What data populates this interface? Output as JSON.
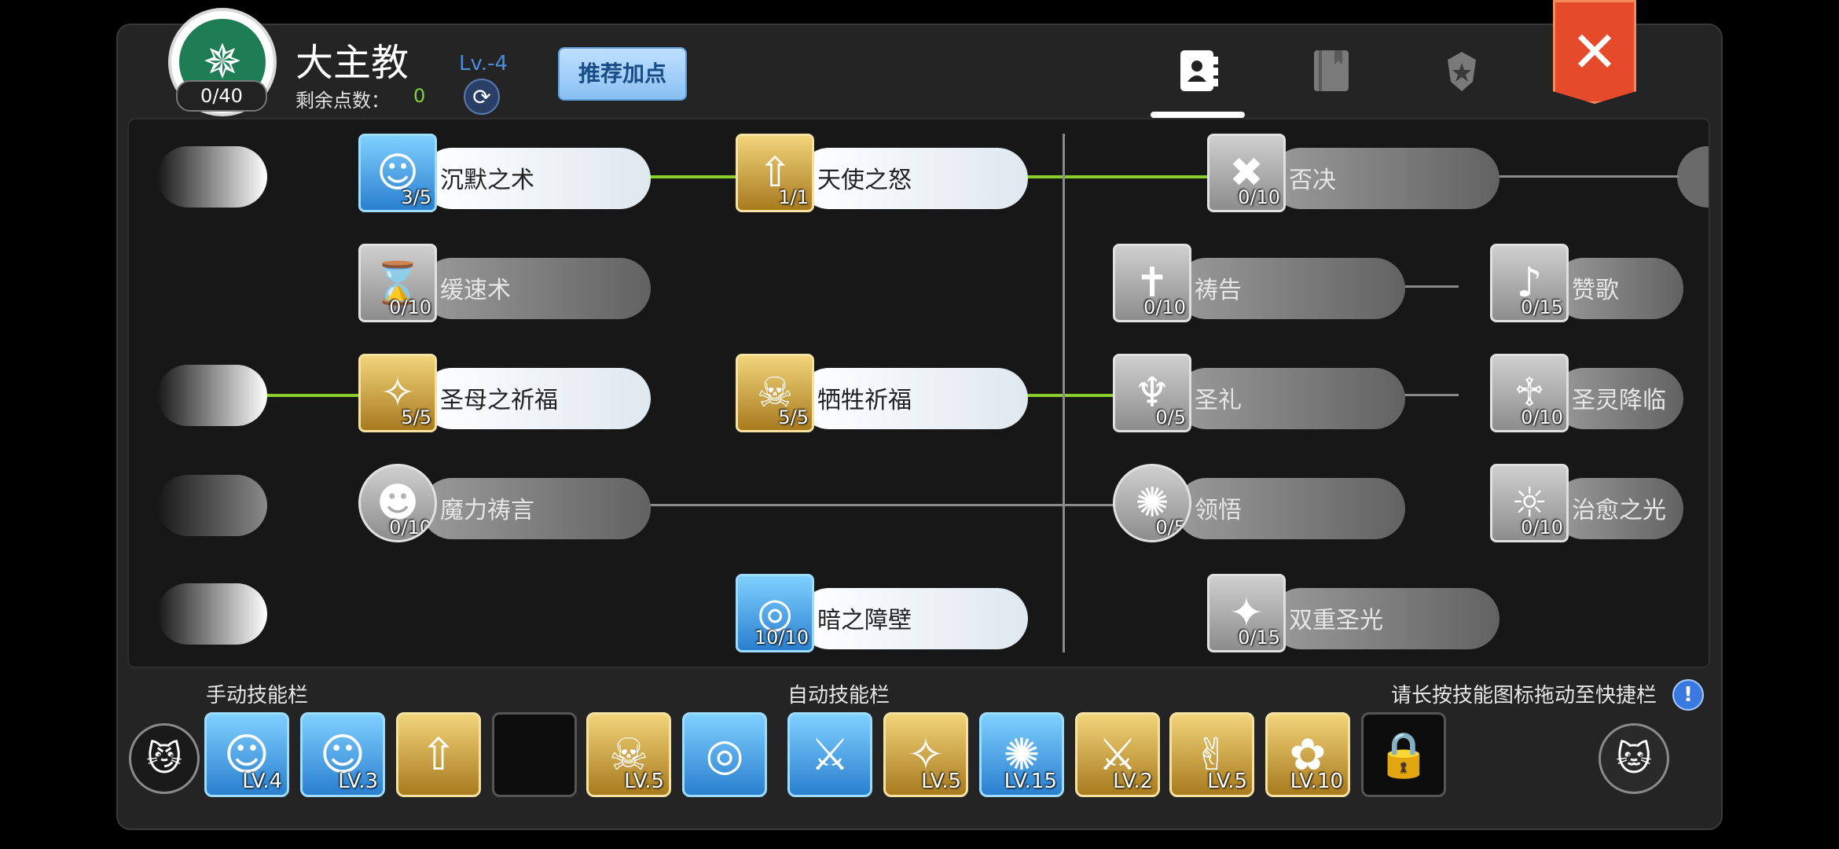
{
  "header": {
    "class_name": "大主教",
    "level": "Lv.-4",
    "remaining_label": "剩余点数：",
    "remaining_value": "0",
    "points_badge": "0/40",
    "recommend_label": "推荐加点",
    "close_label": "✕"
  },
  "tabs": [
    {
      "name": "skill-tree",
      "active": true
    },
    {
      "name": "skill-book",
      "active": false
    },
    {
      "name": "emblem",
      "active": false
    }
  ],
  "skills": [
    {
      "label": "沉默之术",
      "level": "3/5",
      "glyph": "☺",
      "style": "blue",
      "active": true
    },
    {
      "label": "缓速术",
      "level": "0/10",
      "glyph": "⌛",
      "style": "gray",
      "active": false
    },
    {
      "label": "圣母之祈福",
      "level": "5/5",
      "glyph": "✧",
      "style": "gold",
      "active": true
    },
    {
      "label": "魔力祷言",
      "level": "0/10",
      "glyph": "☻",
      "style": "gray",
      "active": false
    },
    {
      "label": "天使之怒",
      "level": "1/1",
      "glyph": "⇧",
      "style": "gold",
      "active": true
    },
    {
      "label": "牺牲祈福",
      "level": "5/5",
      "glyph": "☠",
      "style": "gold",
      "active": true
    },
    {
      "label": "暗之障壁",
      "level": "10/10",
      "glyph": "◎",
      "style": "blue",
      "active": true
    },
    {
      "label": "否决",
      "level": "0/10",
      "glyph": "✖",
      "style": "gray",
      "active": false
    },
    {
      "label": "祷告",
      "level": "0/10",
      "glyph": "✝",
      "style": "gray",
      "active": false
    },
    {
      "label": "圣礼",
      "level": "0/5",
      "glyph": "♆",
      "style": "gray",
      "active": false
    },
    {
      "label": "领悟",
      "level": "0/5",
      "glyph": "✺",
      "style": "gray",
      "active": false
    },
    {
      "label": "双重圣光",
      "level": "0/15",
      "glyph": "✦",
      "style": "gray",
      "active": false
    },
    {
      "label": "赞歌",
      "level": "0/15",
      "glyph": "♪",
      "style": "gray",
      "active": false
    },
    {
      "label": "圣灵降临",
      "level": "0/10",
      "glyph": "♱",
      "style": "gray",
      "active": false
    },
    {
      "label": "治愈之光",
      "level": "0/10",
      "glyph": "☼",
      "style": "gray",
      "active": false
    }
  ],
  "manual_bar": {
    "label": "手动技能栏",
    "slots": [
      {
        "glyph": "☺",
        "style": "blue",
        "level": "LV.4"
      },
      {
        "glyph": "☺",
        "style": "blue",
        "level": "LV.3"
      },
      {
        "glyph": "⇧",
        "style": "gold",
        "level": ""
      },
      {
        "glyph": "",
        "style": "empty",
        "level": ""
      },
      {
        "glyph": "☠",
        "style": "gold",
        "level": "LV.5"
      },
      {
        "glyph": "◎",
        "style": "blue",
        "level": ""
      }
    ]
  },
  "auto_bar": {
    "label": "自动技能栏",
    "slots": [
      {
        "glyph": "⚔",
        "style": "blue",
        "level": ""
      },
      {
        "glyph": "✧",
        "style": "gold",
        "level": "LV.5"
      },
      {
        "glyph": "✺",
        "style": "blue",
        "level": "LV.15"
      },
      {
        "glyph": "⚔",
        "style": "gold",
        "level": "LV.2"
      },
      {
        "glyph": "✌",
        "style": "gold",
        "level": "LV.5"
      },
      {
        "glyph": "✿",
        "style": "gold",
        "level": "LV.10"
      },
      {
        "glyph": "🔒",
        "style": "empty",
        "level": ""
      }
    ]
  },
  "hint": "请长按技能图标拖动至快捷栏",
  "hint_icon": "!"
}
